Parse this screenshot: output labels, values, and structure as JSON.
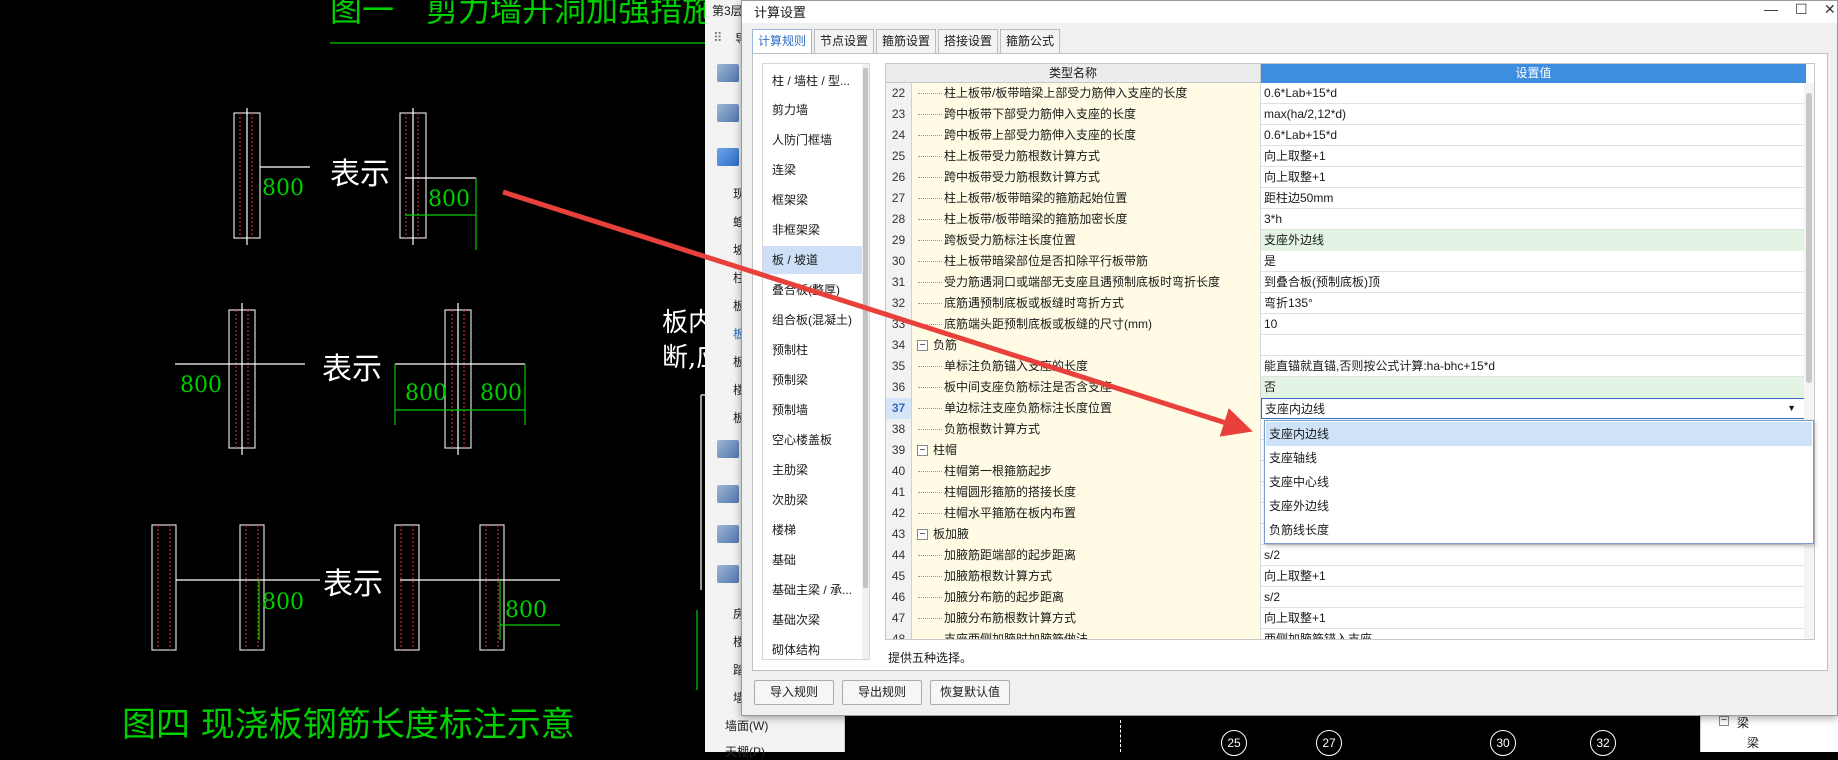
{
  "cad": {
    "fig_top_title": "图一　剪力墙开洞加强措施",
    "fig_bottom_title": "图四 现浇板钢筋长度标注示意",
    "biaoshi": "表示",
    "dim": "800",
    "side_note_1": "板内钢",
    "side_note_2": "断,应",
    "left_panel_label": "第3层",
    "left_panel_letter": "导",
    "strip_items": [
      "现",
      "蝗",
      "坡",
      "柱",
      "板",
      "板",
      "板",
      "楼",
      "板",
      "房",
      "楼",
      "踏",
      "墙"
    ],
    "strip_wall": "墙面(W)",
    "strip_bottom": "天棚(P)",
    "axis_labels": [
      "25",
      "27",
      "30",
      "32"
    ],
    "right_panel_item1": "梁",
    "right_panel_item2": "梁"
  },
  "dialog": {
    "title": "计算设置",
    "minimize": "—",
    "maximize": "☐",
    "close": "✕",
    "tabs": [
      "计算规则",
      "节点设置",
      "箍筋设置",
      "搭接设置",
      "箍筋公式"
    ],
    "categories": [
      "柱 / 墙柱 / 型...",
      "剪力墙",
      "人防门框墙",
      "连梁",
      "框架梁",
      "非框架梁",
      "板 / 坡道",
      "叠合板(整厚)",
      "组合板(混凝土)",
      "预制柱",
      "预制梁",
      "预制墙",
      "空心楼盖板",
      "主肋梁",
      "次肋梁",
      "楼梯",
      "基础",
      "基础主梁 / 承...",
      "基础次梁",
      "砌体结构"
    ],
    "table_headers": {
      "name": "类型名称",
      "value": "设置值"
    },
    "rows": [
      {
        "n": "22",
        "name": "柱上板带/板带暗梁上部受力筋伸入支座的长度",
        "value": "0.6*Lab+15*d",
        "type": "item",
        "bg": ""
      },
      {
        "n": "23",
        "name": "跨中板带下部受力筋伸入支座的长度",
        "value": "max(ha/2,12*d)",
        "type": "item",
        "bg": ""
      },
      {
        "n": "24",
        "name": "跨中板带上部受力筋伸入支座的长度",
        "value": "0.6*Lab+15*d",
        "type": "item",
        "bg": ""
      },
      {
        "n": "25",
        "name": "柱上板带受力筋根数计算方式",
        "value": "向上取整+1",
        "type": "item",
        "bg": ""
      },
      {
        "n": "26",
        "name": "跨中板带受力筋根数计算方式",
        "value": "向上取整+1",
        "type": "item",
        "bg": ""
      },
      {
        "n": "27",
        "name": "柱上板带/板带暗梁的箍筋起始位置",
        "value": "距柱边50mm",
        "type": "item",
        "bg": ""
      },
      {
        "n": "28",
        "name": "柱上板带/板带暗梁的箍筋加密长度",
        "value": "3*h",
        "type": "item",
        "bg": ""
      },
      {
        "n": "29",
        "name": "跨板受力筋标注长度位置",
        "value": "支座外边线",
        "type": "item",
        "bg": "g"
      },
      {
        "n": "30",
        "name": "柱上板带暗梁部位是否扣除平行板带筋",
        "value": "是",
        "type": "item",
        "bg": ""
      },
      {
        "n": "31",
        "name": "受力筋遇洞口或端部无支座且遇预制底板时弯折长度",
        "value": "到叠合板(预制底板)顶",
        "type": "item",
        "bg": ""
      },
      {
        "n": "32",
        "name": "底筋遇预制底板或板缝时弯折方式",
        "value": "弯折135°",
        "type": "item",
        "bg": ""
      },
      {
        "n": "33",
        "name": "底筋端头距预制底板或板缝的尺寸(mm)",
        "value": "10",
        "type": "item",
        "bg": ""
      },
      {
        "n": "34",
        "name": "负筋",
        "value": "",
        "type": "group",
        "bg": ""
      },
      {
        "n": "35",
        "name": "单标注负筋锚入支座的长度",
        "value": "能直锚就直锚,否则按公式计算:ha-bhc+15*d",
        "type": "item",
        "bg": ""
      },
      {
        "n": "36",
        "name": "板中间支座负筋标注是否含支座",
        "value": "否",
        "type": "item",
        "bg": "g"
      },
      {
        "n": "37",
        "name": "单边标注支座负筋标注长度位置",
        "value": "支座内边线",
        "type": "item",
        "bg": "sel"
      },
      {
        "n": "38",
        "name": "负筋根数计算方式",
        "value": "",
        "type": "item",
        "bg": ""
      },
      {
        "n": "39",
        "name": "柱帽",
        "value": "",
        "type": "group",
        "bg": ""
      },
      {
        "n": "40",
        "name": "柱帽第一根箍筋起步",
        "value": "",
        "type": "item",
        "bg": ""
      },
      {
        "n": "41",
        "name": "柱帽圆形箍筋的搭接长度",
        "value": "",
        "type": "item",
        "bg": ""
      },
      {
        "n": "42",
        "name": "柱帽水平箍筋在板内布置",
        "value": "",
        "type": "item",
        "bg": ""
      },
      {
        "n": "43",
        "name": "板加腋",
        "value": "",
        "type": "group",
        "bg": ""
      },
      {
        "n": "44",
        "name": "加腋筋距端部的起步距离",
        "value": "s/2",
        "type": "item",
        "bg": ""
      },
      {
        "n": "45",
        "name": "加腋筋根数计算方式",
        "value": "向上取整+1",
        "type": "item",
        "bg": ""
      },
      {
        "n": "46",
        "name": "加腋分布筋的起步距离",
        "value": "s/2",
        "type": "item",
        "bg": ""
      },
      {
        "n": "47",
        "name": "加腋分布筋根数计算方式",
        "value": "向上取整+1",
        "type": "item",
        "bg": ""
      },
      {
        "n": "48",
        "name": "支座两侧加腋时加腋筋做法",
        "value": "两侧加腋筋锚入支座",
        "type": "item",
        "bg": ""
      }
    ],
    "dropdown_options": [
      "支座内边线",
      "支座轴线",
      "支座中心线",
      "支座外边线",
      "负筋线长度"
    ],
    "dropdown_selected": 0,
    "tip": "提供五种选择。",
    "buttons": [
      "导入规则",
      "导出规则",
      "恢复默认值"
    ]
  },
  "colors": {
    "cad_green": "#00d000",
    "accent": "#3e8ee0",
    "arrow": "#e8403a"
  }
}
